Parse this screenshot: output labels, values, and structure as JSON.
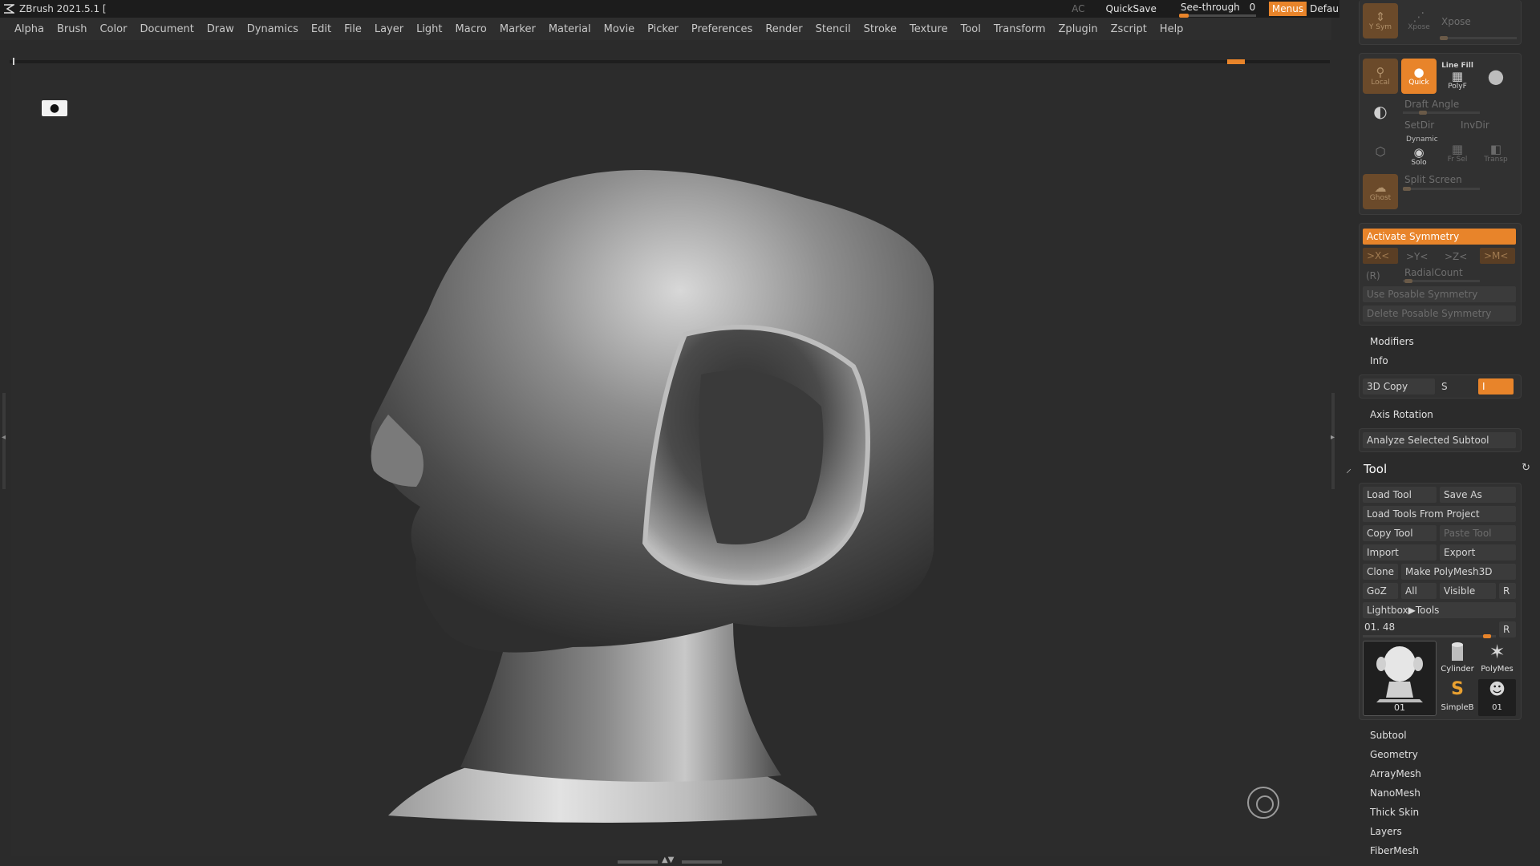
{
  "app": {
    "title": "ZBrush 2021.5.1 ["
  },
  "titlebar": {
    "ac": "AC",
    "quicksave": "QuickSave",
    "see_through_label": "See-through",
    "see_through_value": "0",
    "menus": "Menus",
    "default_zscript": "DefaultZScript"
  },
  "menu": [
    "Alpha",
    "Brush",
    "Color",
    "Document",
    "Draw",
    "Dynamics",
    "Edit",
    "File",
    "Layer",
    "Light",
    "Macro",
    "Marker",
    "Material",
    "Movie",
    "Picker",
    "Preferences",
    "Render",
    "Stencil",
    "Stroke",
    "Texture",
    "Tool",
    "Transform",
    "Zplugin",
    "Zscript",
    "Help"
  ],
  "right_shelf": {
    "top_partial": {
      "ysym": "Y Sym",
      "xpose": "Xpose",
      "xpose2": "Xpose"
    },
    "local": "Local",
    "quick": "Quick",
    "line_fill": "Line Fill",
    "polyf": "PolyF",
    "draft_angle": "Draft Angle",
    "setdir": "SetDir",
    "invdir": "InvDir",
    "dynamic": "Dynamic",
    "solo": "Solo",
    "frsel": "Fr Sel",
    "transp": "Transp",
    "ghost": "Ghost",
    "split_screen": "Split Screen"
  },
  "symmetry": {
    "activate": "Activate Symmetry",
    "x": ">X<",
    "y": ">Y<",
    "z": ">Z<",
    "m": ">M<",
    "r": "(R)",
    "radial_count": "RadialCount",
    "use_posable": "Use Posable Symmetry",
    "delete_posable": "Delete Posable Symmetry"
  },
  "sections": {
    "modifiers": "Modifiers",
    "info": "Info",
    "axis_rotation": "Axis Rotation"
  },
  "copy3d": {
    "label": "3D Copy",
    "s": "S",
    "i": "I"
  },
  "analyze": "Analyze Selected Subtool",
  "tool": {
    "title": "Tool",
    "load_tool": "Load Tool",
    "save_as": "Save As",
    "load_from_project": "Load Tools From Project",
    "copy_tool": "Copy Tool",
    "paste_tool": "Paste Tool",
    "import": "Import",
    "export": "Export",
    "clone": "Clone",
    "make_polymesh": "Make PolyMesh3D",
    "goz": "GoZ",
    "all": "All",
    "visible": "Visible",
    "r": "R",
    "lightbox_tools": "Lightbox▶Tools",
    "slider_label": "01. 48",
    "slider_r": "R",
    "thumbs": {
      "main": "01",
      "cylinder": "Cylinder",
      "polymesh": "PolyMes",
      "simpleb": "SimpleB",
      "small": "01"
    }
  },
  "tool_sections": [
    "Subtool",
    "Geometry",
    "ArrayMesh",
    "NanoMesh",
    "Thick Skin",
    "Layers",
    "FiberMesh"
  ],
  "colors": {
    "accent": "#e8842a",
    "bg": "#2b2b2b",
    "panel": "#313131"
  },
  "icons": {
    "app_logo": "zbrush-logo-icon",
    "persp": "bust-icon",
    "gyro": "navigation-circle-icon",
    "tool_icon": "brush-icon",
    "refresh": "refresh-icon"
  }
}
